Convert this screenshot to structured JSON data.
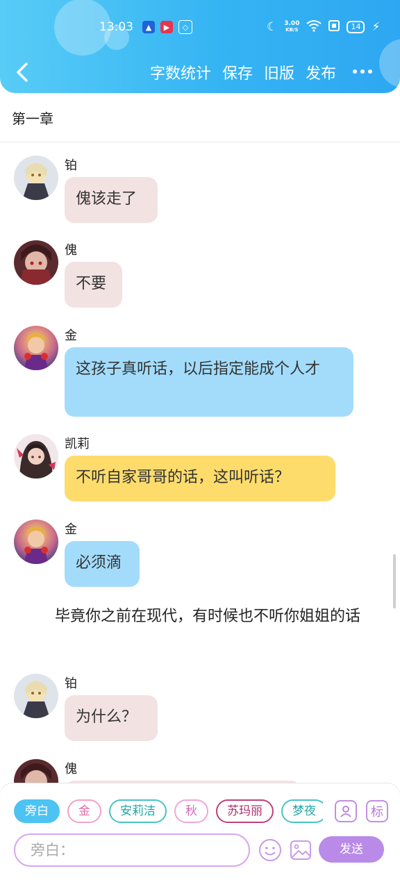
{
  "status_bar": {
    "time": "13:03",
    "net_speed_value": "3.00",
    "net_speed_unit": "KB/S",
    "battery": "14"
  },
  "toolbar": {
    "word_count": "字数统计",
    "save": "保存",
    "old_version": "旧版",
    "publish": "发布"
  },
  "chapter_title": "第一章",
  "messages": [
    {
      "name": "铂",
      "text": "傀该走了",
      "bubble_color": "#f3e2e2",
      "avatar": "avatar-platinum"
    },
    {
      "name": "傀",
      "text": "不要",
      "bubble_color": "#f3e2e2",
      "avatar": "avatar-kui"
    },
    {
      "name": "金",
      "text": "这孩子真听话，以后指定能成个人才",
      "bubble_color": "#a3dcfb",
      "avatar": "avatar-jin"
    },
    {
      "name": "凯莉",
      "text": "不听自家哥哥的话，这叫听话？",
      "bubble_color": "#fedc6c",
      "avatar": "avatar-kelly"
    },
    {
      "name": "金",
      "text": "必须滴",
      "bubble_color": "#a3dcfb",
      "avatar": "avatar-jin"
    },
    {
      "name": "铂",
      "text": "为什么？",
      "bubble_color": "#f3e2e2",
      "avatar": "avatar-platinum"
    },
    {
      "name": "傀",
      "text": "",
      "bubble_color": "#f3e2e2",
      "avatar": "avatar-kui"
    }
  ],
  "narration": "毕竟你之前在现代，有时候也不听你姐姐的话",
  "role_chips": [
    "旁白",
    "金",
    "安莉洁",
    "秋",
    "苏玛丽",
    "梦夜"
  ],
  "tools": {
    "mark": "标"
  },
  "input": {
    "placeholder": "旁白："
  },
  "send_label": "发送",
  "colors": {
    "header": "#35b4f3",
    "accent_purple": "#b98ae8",
    "narration_chip": "#4cc3f3"
  }
}
